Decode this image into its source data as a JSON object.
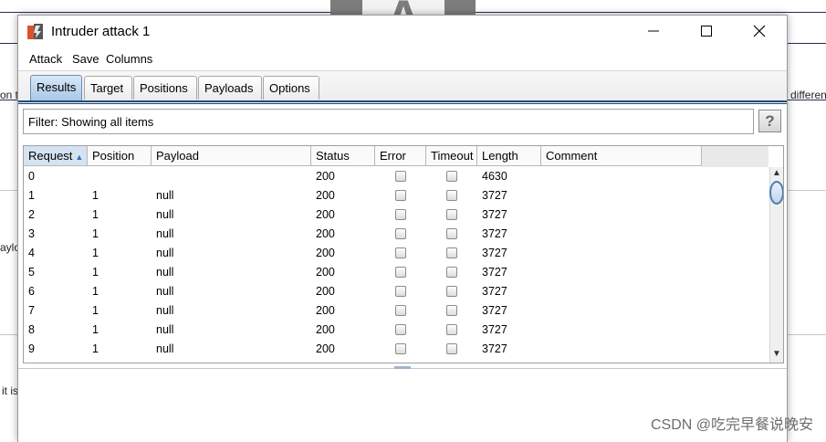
{
  "background": {
    "fragments": [
      "on th",
      "differen",
      "aylo",
      "it is"
    ],
    "logo_letter": "A"
  },
  "window": {
    "title": "Intruder attack 1",
    "controls": [
      "minimize",
      "maximize",
      "close"
    ]
  },
  "menu": [
    "Attack",
    "Save",
    "Columns"
  ],
  "tabs": [
    {
      "label": "Results",
      "active": true
    },
    {
      "label": "Target",
      "active": false
    },
    {
      "label": "Positions",
      "active": false
    },
    {
      "label": "Payloads",
      "active": false
    },
    {
      "label": "Options",
      "active": false
    }
  ],
  "filter": {
    "label": "Filter: Showing all items",
    "help": "?"
  },
  "table": {
    "sort_column": "Request",
    "sort_direction": "ascending",
    "columns": [
      "Request",
      "Position",
      "Payload",
      "Status",
      "Error",
      "Timeout",
      "Length",
      "Comment"
    ],
    "rows": [
      {
        "request": "0",
        "position": "",
        "payload": "",
        "status": "200",
        "error": false,
        "timeout": false,
        "length": "4630",
        "comment": ""
      },
      {
        "request": "1",
        "position": "1",
        "payload": "null",
        "status": "200",
        "error": false,
        "timeout": false,
        "length": "3727",
        "comment": ""
      },
      {
        "request": "2",
        "position": "1",
        "payload": "null",
        "status": "200",
        "error": false,
        "timeout": false,
        "length": "3727",
        "comment": ""
      },
      {
        "request": "3",
        "position": "1",
        "payload": "null",
        "status": "200",
        "error": false,
        "timeout": false,
        "length": "3727",
        "comment": ""
      },
      {
        "request": "4",
        "position": "1",
        "payload": "null",
        "status": "200",
        "error": false,
        "timeout": false,
        "length": "3727",
        "comment": ""
      },
      {
        "request": "5",
        "position": "1",
        "payload": "null",
        "status": "200",
        "error": false,
        "timeout": false,
        "length": "3727",
        "comment": ""
      },
      {
        "request": "6",
        "position": "1",
        "payload": "null",
        "status": "200",
        "error": false,
        "timeout": false,
        "length": "3727",
        "comment": ""
      },
      {
        "request": "7",
        "position": "1",
        "payload": "null",
        "status": "200",
        "error": false,
        "timeout": false,
        "length": "3727",
        "comment": ""
      },
      {
        "request": "8",
        "position": "1",
        "payload": "null",
        "status": "200",
        "error": false,
        "timeout": false,
        "length": "3727",
        "comment": ""
      },
      {
        "request": "9",
        "position": "1",
        "payload": "null",
        "status": "200",
        "error": false,
        "timeout": false,
        "length": "3727",
        "comment": ""
      }
    ]
  },
  "scrollbar": {
    "up_glyph": "▲",
    "down_glyph": "▼"
  },
  "watermark": "CSDN @吃完早餐说晚安",
  "colors": {
    "active_tab": "#a9c7e6",
    "tab_rule": "#234a7c",
    "app_icon": "#d9532b"
  }
}
